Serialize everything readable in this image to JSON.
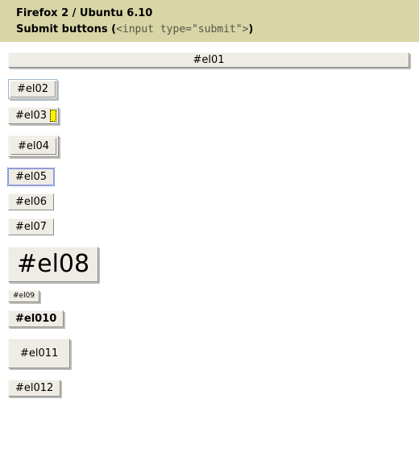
{
  "header": {
    "line1": "Firefox 2 / Ubuntu 6.10",
    "line2_prefix": "Submit buttons (",
    "line2_code": "<input type=\"submit\">",
    "line2_suffix": ")"
  },
  "buttons": {
    "el01": "#el01",
    "el02": "#el02",
    "el03": "#el03",
    "el04": "#el04",
    "el05": "#el05",
    "el06": "#el06",
    "el07": "#el07",
    "el08": "#el08",
    "el09": "#el09",
    "el010": "#el010",
    "el011": "#el011",
    "el012": "#el012"
  }
}
